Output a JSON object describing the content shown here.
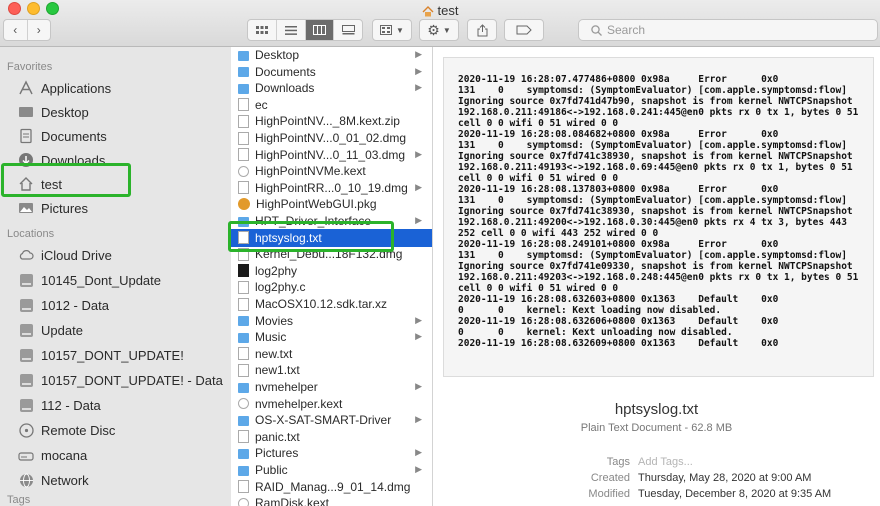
{
  "window": {
    "title": "test"
  },
  "toolbar": {
    "search_placeholder": "Search"
  },
  "sidebar": {
    "favorites_header": "Favorites",
    "favorites": [
      {
        "label": "Applications",
        "icon": "applications-icon"
      },
      {
        "label": "Desktop",
        "icon": "desktop-icon"
      },
      {
        "label": "Documents",
        "icon": "documents-icon"
      },
      {
        "label": "Downloads",
        "icon": "downloads-icon"
      },
      {
        "label": "test",
        "icon": "home-icon"
      },
      {
        "label": "Pictures",
        "icon": "pictures-icon"
      }
    ],
    "locations_header": "Locations",
    "locations": [
      {
        "label": "iCloud Drive",
        "icon": "cloud-icon"
      },
      {
        "label": "10145_Dont_Update",
        "icon": "disk-icon"
      },
      {
        "label": "1012 - Data",
        "icon": "disk-icon"
      },
      {
        "label": "Update",
        "icon": "disk-icon"
      },
      {
        "label": "10157_DONT_UPDATE!",
        "icon": "disk-icon"
      },
      {
        "label": "10157_DONT_UPDATE! - Data",
        "icon": "disk-icon"
      },
      {
        "label": "112 - Data",
        "icon": "disk-icon"
      },
      {
        "label": "Remote Disc",
        "icon": "disc-icon"
      },
      {
        "label": "mocana",
        "icon": "network-drive-icon"
      },
      {
        "label": "Network",
        "icon": "network-icon"
      }
    ],
    "tags_header": "Tags"
  },
  "files": [
    {
      "name": "Desktop",
      "kind": "folder",
      "arrow": true
    },
    {
      "name": "Documents",
      "kind": "folder",
      "arrow": true
    },
    {
      "name": "Downloads",
      "kind": "folder",
      "arrow": true
    },
    {
      "name": "ec",
      "kind": "doc",
      "arrow": false
    },
    {
      "name": "HighPointNV..._8M.kext.zip",
      "kind": "doc",
      "arrow": false
    },
    {
      "name": "HighPointNV...0_01_02.dmg",
      "kind": "doc",
      "arrow": false
    },
    {
      "name": "HighPointNV...0_11_03.dmg",
      "kind": "doc",
      "arrow": true
    },
    {
      "name": "HighPointNVMe.kext",
      "kind": "kext",
      "arrow": false
    },
    {
      "name": "HighPointRR...0_10_19.dmg",
      "kind": "doc",
      "arrow": true
    },
    {
      "name": "HighPointWebGUI.pkg",
      "kind": "orange",
      "arrow": false
    },
    {
      "name": "HPT_Driver_Interface",
      "kind": "folder",
      "arrow": true
    },
    {
      "name": "hptsyslog.txt",
      "kind": "doc",
      "arrow": false,
      "selected": true
    },
    {
      "name": "Kernel_Debu...18F132.dmg",
      "kind": "doc",
      "arrow": false
    },
    {
      "name": "log2phy",
      "kind": "black",
      "arrow": false
    },
    {
      "name": "log2phy.c",
      "kind": "doc",
      "arrow": false
    },
    {
      "name": "MacOSX10.12.sdk.tar.xz",
      "kind": "doc",
      "arrow": false
    },
    {
      "name": "Movies",
      "kind": "folder",
      "arrow": true
    },
    {
      "name": "Music",
      "kind": "folder",
      "arrow": true
    },
    {
      "name": "new.txt",
      "kind": "doc",
      "arrow": false
    },
    {
      "name": "new1.txt",
      "kind": "doc",
      "arrow": false
    },
    {
      "name": "nvmehelper",
      "kind": "folder",
      "arrow": true
    },
    {
      "name": "nvmehelper.kext",
      "kind": "kext",
      "arrow": false
    },
    {
      "name": "OS-X-SAT-SMART-Driver",
      "kind": "folder",
      "arrow": true
    },
    {
      "name": "panic.txt",
      "kind": "doc",
      "arrow": false
    },
    {
      "name": "Pictures",
      "kind": "folder",
      "arrow": true
    },
    {
      "name": "Public",
      "kind": "folder",
      "arrow": true
    },
    {
      "name": "RAID_Manag...9_01_14.dmg",
      "kind": "doc",
      "arrow": false
    },
    {
      "name": "RamDisk.kext",
      "kind": "kext",
      "arrow": false
    }
  ],
  "preview": {
    "log_lines": [
      "2020-11-19 16:28:07.477486+0800 0x98a     Error      0x0",
      "131    0    symptomsd: (SymptomEvaluator) [com.apple.symptomsd:flow]",
      "Ignoring source 0x7fd741d47b90, snapshot is from kernel NWTCPSnapshot",
      "192.168.0.211:49186<->192.168.0.241:445@en0 pkts rx 0 tx 1, bytes 0 51",
      "cell 0 0 wifi 0 51 wired 0 0",
      "2020-11-19 16:28:08.084682+0800 0x98a     Error      0x0",
      "131    0    symptomsd: (SymptomEvaluator) [com.apple.symptomsd:flow]",
      "Ignoring source 0x7fd741c38930, snapshot is from kernel NWTCPSnapshot",
      "192.168.0.211:49193<->192.168.0.69:445@en0 pkts rx 0 tx 1, bytes 0 51",
      "cell 0 0 wifi 0 51 wired 0 0",
      "2020-11-19 16:28:08.137803+0800 0x98a     Error      0x0",
      "131    0    symptomsd: (SymptomEvaluator) [com.apple.symptomsd:flow]",
      "Ignoring source 0x7fd741c38930, snapshot is from kernel NWTCPSnapshot",
      "192.168.0.211:49200<->192.168.0.30:445@en0 pkts rx 4 tx 3, bytes 443",
      "252 cell 0 0 wifi 443 252 wired 0 0",
      "2020-11-19 16:28:08.249101+0800 0x98a     Error      0x0",
      "131    0    symptomsd: (SymptomEvaluator) [com.apple.symptomsd:flow]",
      "Ignoring source 0x7fd741e09330, snapshot is from kernel NWTCPSnapshot",
      "192.168.0.211:49203<->192.168.0.248:445@en0 pkts rx 0 tx 1, bytes 0 51",
      "cell 0 0 wifi 0 51 wired 0 0",
      "2020-11-19 16:28:08.632603+0800 0x1363    Default    0x0",
      "0      0    kernel: Kext loading now disabled.",
      "2020-11-19 16:28:08.632606+0800 0x1363    Default    0x0",
      "0      0    kernel: Kext unloading now disabled.",
      "2020-11-19 16:28:08.632609+0800 0x1363    Default    0x0"
    ],
    "file_name": "hptsyslog.txt",
    "kind_size": "Plain Text Document - 62.8 MB",
    "tags_label": "Tags",
    "tags_placeholder": "Add Tags...",
    "created_label": "Created",
    "created_value": "Thursday, May 28, 2020 at 9:00 AM",
    "modified_label": "Modified",
    "modified_value": "Tuesday, December 8, 2020 at 9:35 AM"
  },
  "colors": {
    "selection": "#1a62d6",
    "highlight": "#2bb32b",
    "sidebar_bg": "#e6e6e6"
  }
}
